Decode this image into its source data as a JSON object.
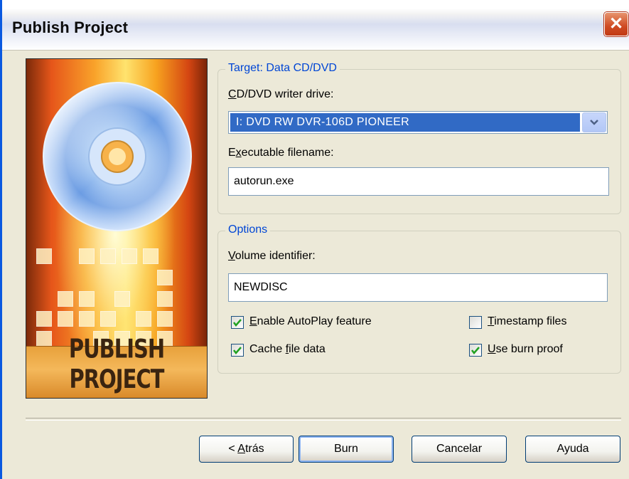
{
  "window": {
    "title": "Publish Project",
    "close_symbol": "✕"
  },
  "sidebar": {
    "banner": "PUBLISH PROJECT",
    "graphic": "disc-icon"
  },
  "target": {
    "legend": "Target: Data CD/DVD",
    "drive_label_first": "C",
    "drive_label_rest": "D/DVD writer drive:",
    "drive_value": "I: DVD RW  DVR-106D PIONEER",
    "exe_label_first": "E",
    "exe_label_u": "x",
    "exe_label_rest": "ecutable filename:",
    "exe_value": "autorun.exe"
  },
  "options": {
    "legend": "Options",
    "volume_label_u": "V",
    "volume_label_rest": "olume identifier:",
    "volume_value": "NEWDISC",
    "checkboxes": [
      {
        "u": "E",
        "rest": "nable AutoPlay feature",
        "checked": true
      },
      {
        "pre": "Cache ",
        "u": "f",
        "rest": "ile data",
        "checked": true
      },
      {
        "u": "T",
        "rest": "imestamp files",
        "checked": false
      },
      {
        "u": "U",
        "rest": "se burn proof",
        "checked": true
      }
    ]
  },
  "buttons": {
    "back_prefix": "< ",
    "back_u": "A",
    "back_rest": "trás",
    "burn": "Burn",
    "cancel": "Cancelar",
    "help": "Ayuda"
  },
  "colors": {
    "accent": "#0046D5",
    "selection": "#316AC5",
    "check": "#21A121"
  }
}
